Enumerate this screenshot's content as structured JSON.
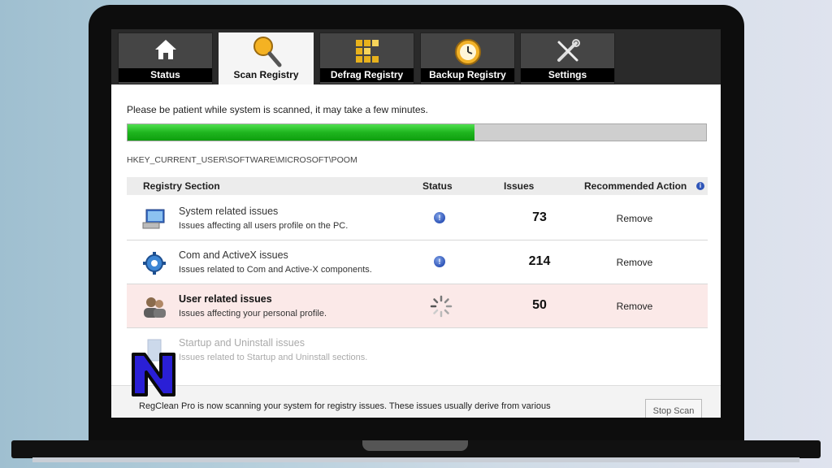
{
  "tabs": [
    {
      "label": "Status",
      "icon": "home-icon"
    },
    {
      "label": "Scan Registry",
      "icon": "magnifier-icon",
      "active": true
    },
    {
      "label": "Defrag Registry",
      "icon": "defrag-blocks-icon"
    },
    {
      "label": "Backup Registry",
      "icon": "clock-backup-icon"
    },
    {
      "label": "Settings",
      "icon": "tools-icon"
    }
  ],
  "scan": {
    "message": "Please be patient while system is scanned, it may take a few minutes.",
    "progress_fraction": 0.6,
    "current_key": "HKEY_CURRENT_USER\\SOFTWARE\\MICROSOFT\\POOM"
  },
  "table": {
    "headers": {
      "section": "Registry Section",
      "status": "Status",
      "issues": "Issues",
      "action": "Recommended Action",
      "info": "i"
    },
    "rows": [
      {
        "title": "System related issues",
        "desc": "Issues affecting all users profile on the PC.",
        "issues": "73",
        "action": "Remove",
        "state": "done",
        "icon": "monitor-icon"
      },
      {
        "title": "Com and ActiveX issues",
        "desc": "Issues related to Com and Active-X components.",
        "issues": "214",
        "action": "Remove",
        "state": "done",
        "icon": "gear-icon"
      },
      {
        "title": "User related issues",
        "desc": "Issues affecting your personal profile.",
        "issues": "50",
        "action": "Remove",
        "state": "scanning",
        "icon": "users-icon"
      },
      {
        "title": "Startup and Uninstall issues",
        "desc": "Issues related to Startup and Uninstall sections.",
        "issues": "",
        "action": "",
        "state": "pending",
        "icon": "uninstall-icon"
      }
    ]
  },
  "footer": {
    "text": "RegClean Pro is now scanning your system for registry issues. These issues usually derive from various",
    "stop_label": "Stop Scan"
  },
  "status_icon_glyph": "!",
  "colors": {
    "progress": "#1fb51f",
    "highlight_row": "#fbe9e8",
    "info": "#2f55b8",
    "logo_fill": "#2a1fd6"
  }
}
